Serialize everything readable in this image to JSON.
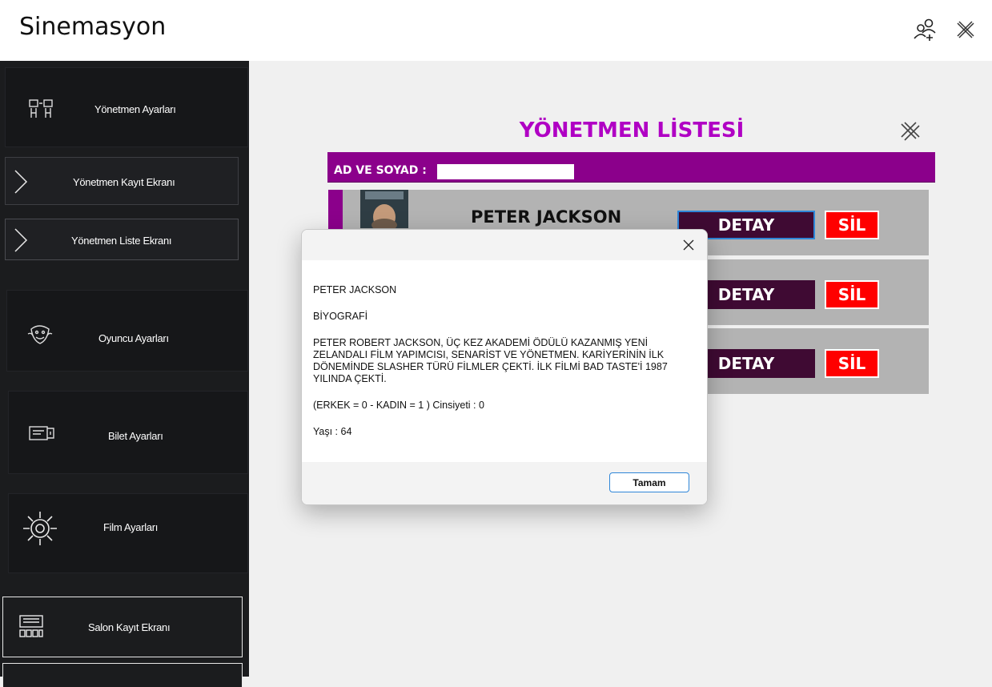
{
  "app": {
    "title": "Sinemasyon"
  },
  "sidebar": {
    "items": [
      {
        "label": "Yönetmen  Ayarları"
      },
      {
        "label": "Yönetmen Kayıt Ekranı"
      },
      {
        "label": "Yönetmen  Liste Ekranı"
      },
      {
        "label": "Oyuncu Ayarları"
      },
      {
        "label": "Bilet Ayarları"
      },
      {
        "label": "Film Ayarları"
      },
      {
        "label": "Salon Kayıt Ekranı"
      }
    ]
  },
  "panel": {
    "title": "YÖNETMEN LİSTESİ",
    "search_label": "AD VE SOYAD :",
    "search_value": "",
    "rows": [
      {
        "name": "PETER JACKSON",
        "detail_label": "DETAY",
        "delete_label": "SİL"
      },
      {
        "name": "",
        "detail_label": "DETAY",
        "delete_label": "SİL"
      },
      {
        "name": "",
        "detail_label": "DETAY",
        "delete_label": "SİL"
      }
    ]
  },
  "dialog": {
    "line1": "PETER JACKSON",
    "line2": "BİYOGRAFİ",
    "line3": "PETER ROBERT JACKSON, ÜÇ KEZ AKADEMİ ÖDÜLÜ KAZANMIŞ YENİ ZELANDALI FİLM YAPIMCISI, SENARİST VE YÖNETMEN. KARİYERİNİN İLK DÖNEMİNDE SLASHER TÜRÜ FİLMLER ÇEKTİ. İLK FİLMİ BAD TASTE'İ 1987 YILINDA ÇEKTİ.",
    "line4": "(ERKEK = 0 - KADIN = 1 ) Cinsiyeti : 0",
    "line5": "Yaşı : 64",
    "ok_label": "Tamam"
  },
  "colors": {
    "accent_purple": "#8b008b",
    "title_magenta": "#b000c4",
    "detail_button": "#3f0a33",
    "delete_button": "#ff0000",
    "sidebar_bg": "#1b1c1e"
  },
  "icons": [
    "add-user-icon",
    "close-icon",
    "director-icon",
    "chevron-right-icon",
    "actor-icon",
    "ticket-icon",
    "gear-icon",
    "cinema-hall-icon"
  ]
}
